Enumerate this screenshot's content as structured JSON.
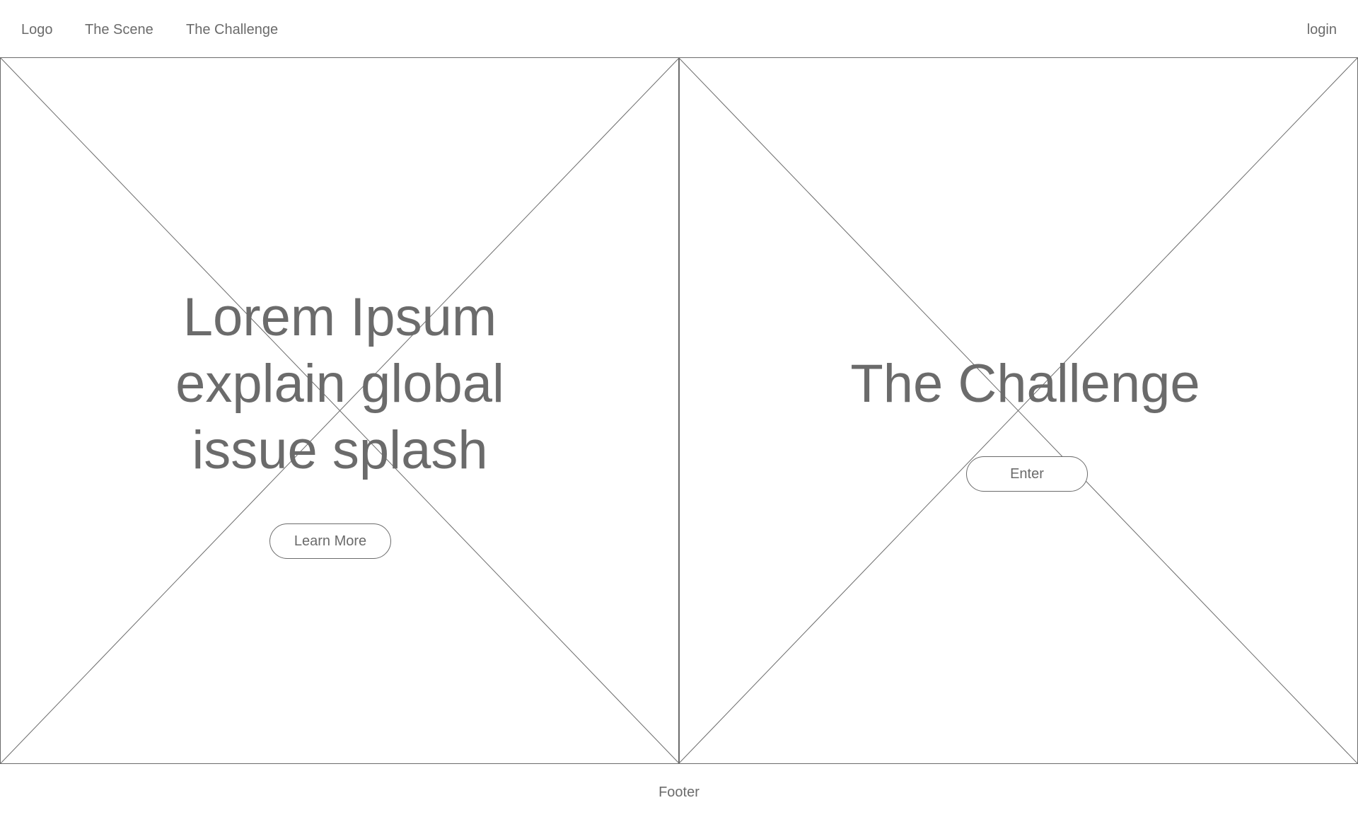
{
  "nav": {
    "logo": "Logo",
    "items": [
      "The Scene",
      "The Challenge"
    ],
    "login": "login"
  },
  "left_panel": {
    "headline": "Lorem Ipsum explain global issue splash",
    "button_label": "Learn More"
  },
  "right_panel": {
    "headline": "The Challenge",
    "button_label": "Enter"
  },
  "footer": {
    "text": "Footer"
  },
  "colors": {
    "line": "#6b6b6b",
    "text": "#6b6b6b",
    "background": "#ffffff"
  }
}
